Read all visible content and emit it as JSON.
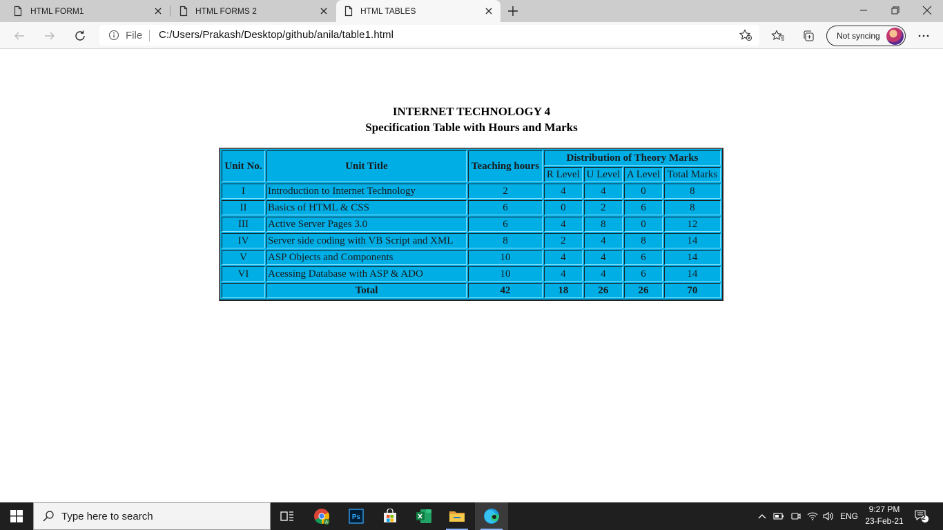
{
  "browser": {
    "tabs": [
      {
        "label": "HTML FORM1",
        "active": false
      },
      {
        "label": "HTML FORMS 2",
        "active": false
      },
      {
        "label": "HTML TABLES",
        "active": true
      }
    ],
    "address": {
      "scheme_label": "File",
      "url": "C:/Users/Prakash/Desktop/github/anila/table1.html"
    },
    "profile": {
      "sync_label": "Not syncing"
    },
    "icons": {
      "back": "back-arrow-icon",
      "forward": "forward-arrow-icon",
      "refresh": "refresh-icon",
      "info": "info-icon",
      "add_favorite": "star-plus-icon",
      "favorites": "favorites-icon",
      "collections": "collections-icon",
      "menu": "more-icon"
    }
  },
  "page": {
    "title": "INTERNET TECHNOLOGY 4",
    "subtitle": "Specification Table with Hours and Marks",
    "table": {
      "background_color": "#00aee6",
      "headers": {
        "unit_no": "Unit No.",
        "unit_title": "Unit Title",
        "teaching_hours": "Teaching hours",
        "distribution": "Distribution of Theory Marks",
        "r_level": "R Level",
        "u_level": "U Level",
        "a_level": "A Level",
        "total_marks": "Total Marks"
      },
      "rows": [
        {
          "unit": "I",
          "title": "Introduction to Internet Technology",
          "hours": "2",
          "r": "4",
          "u": "4",
          "a": "0",
          "total": "8"
        },
        {
          "unit": "II",
          "title": "Basics of HTML & CSS",
          "hours": "6",
          "r": "0",
          "u": "2",
          "a": "6",
          "total": "8"
        },
        {
          "unit": "III",
          "title": "Active Server Pages 3.0",
          "hours": "6",
          "r": "4",
          "u": "8",
          "a": "0",
          "total": "12"
        },
        {
          "unit": "IV",
          "title": "Server side coding with VB Script and XML",
          "hours": "8",
          "r": "2",
          "u": "4",
          "a": "8",
          "total": "14"
        },
        {
          "unit": "V",
          "title": "ASP Objects and Components",
          "hours": "10",
          "r": "4",
          "u": "4",
          "a": "6",
          "total": "14"
        },
        {
          "unit": "VI",
          "title": "Acessing Database with ASP & ADO",
          "hours": "10",
          "r": "4",
          "u": "4",
          "a": "6",
          "total": "14"
        }
      ],
      "total_row": {
        "unit": "",
        "title": "Total",
        "hours": "42",
        "r": "18",
        "u": "26",
        "a": "26",
        "total": "70"
      }
    }
  },
  "taskbar": {
    "search_placeholder": "Type here to search",
    "language": "ENG",
    "time": "9:27 PM",
    "date": "23-Feb-21",
    "notification_count": "2",
    "apps": [
      "task-view",
      "chrome",
      "photoshop",
      "store",
      "excel",
      "file-explorer",
      "edge"
    ]
  }
}
